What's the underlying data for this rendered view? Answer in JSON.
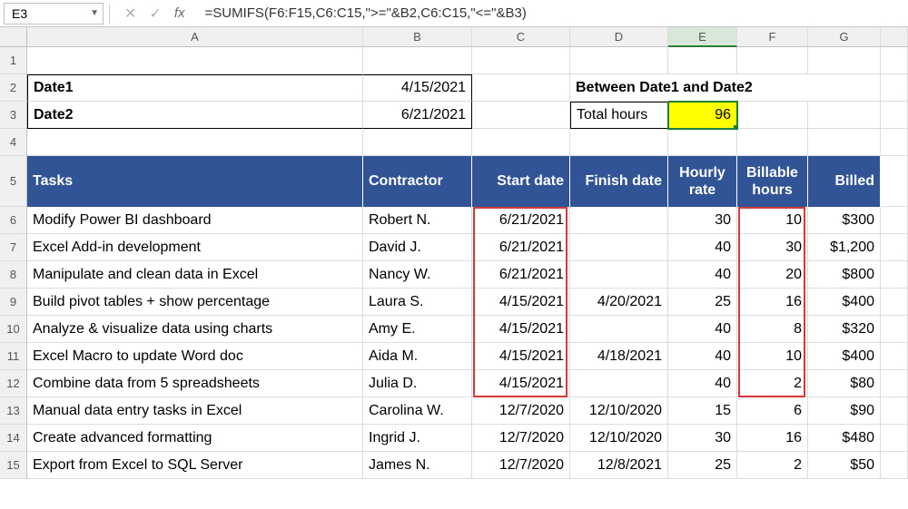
{
  "namebox": "E3",
  "formula": "=SUMIFS(F6:F15,C6:C15,\">=\"&B2,C6:C15,\"<=\"&B3)",
  "columns": [
    "A",
    "B",
    "C",
    "D",
    "E",
    "F",
    "G"
  ],
  "row_numbers": [
    "1",
    "2",
    "3",
    "4",
    "5",
    "6",
    "7",
    "8",
    "9",
    "10",
    "11",
    "12",
    "13",
    "14",
    "15"
  ],
  "labels": {
    "date1": "Date1",
    "date2": "Date2",
    "date1_val": "4/15/2021",
    "date2_val": "6/21/2021",
    "between": "Between Date1 and Date2",
    "total_hours": "Total hours",
    "total_hours_val": "96"
  },
  "headers": {
    "tasks": "Tasks",
    "contractor": "Contractor",
    "start": "Start date",
    "finish": "Finish date",
    "rate1": "Hourly",
    "rate2": "rate",
    "bill1": "Billable",
    "bill2": "hours",
    "billed": "Billed"
  },
  "rows": [
    {
      "task": "Modify Power BI dashboard",
      "contractor": "Robert N.",
      "start": "6/21/2021",
      "finish": "",
      "rate": "30",
      "hours": "10",
      "billed": "$300"
    },
    {
      "task": "Excel Add-in development",
      "contractor": "David J.",
      "start": "6/21/2021",
      "finish": "",
      "rate": "40",
      "hours": "30",
      "billed": "$1,200"
    },
    {
      "task": "Manipulate and clean data in Excel",
      "contractor": "Nancy W.",
      "start": "6/21/2021",
      "finish": "",
      "rate": "40",
      "hours": "20",
      "billed": "$800"
    },
    {
      "task": "Build pivot tables + show percentage",
      "contractor": "Laura S.",
      "start": "4/15/2021",
      "finish": "4/20/2021",
      "rate": "25",
      "hours": "16",
      "billed": "$400"
    },
    {
      "task": "Analyze & visualize data using charts",
      "contractor": "Amy E.",
      "start": "4/15/2021",
      "finish": "",
      "rate": "40",
      "hours": "8",
      "billed": "$320"
    },
    {
      "task": "Excel Macro to update Word doc",
      "contractor": "Aida M.",
      "start": "4/15/2021",
      "finish": "4/18/2021",
      "rate": "40",
      "hours": "10",
      "billed": "$400"
    },
    {
      "task": "Combine data from 5 spreadsheets",
      "contractor": "Julia D.",
      "start": "4/15/2021",
      "finish": "",
      "rate": "40",
      "hours": "2",
      "billed": "$80"
    },
    {
      "task": "Manual data entry tasks in Excel",
      "contractor": "Carolina W.",
      "start": "12/7/2020",
      "finish": "12/10/2020",
      "rate": "15",
      "hours": "6",
      "billed": "$90"
    },
    {
      "task": "Create advanced formatting",
      "contractor": "Ingrid J.",
      "start": "12/7/2020",
      "finish": "12/10/2020",
      "rate": "30",
      "hours": "16",
      "billed": "$480"
    },
    {
      "task": "Export from Excel to SQL Server",
      "contractor": "James N.",
      "start": "12/7/2020",
      "finish": "12/8/2021",
      "rate": "25",
      "hours": "2",
      "billed": "$50"
    }
  ]
}
